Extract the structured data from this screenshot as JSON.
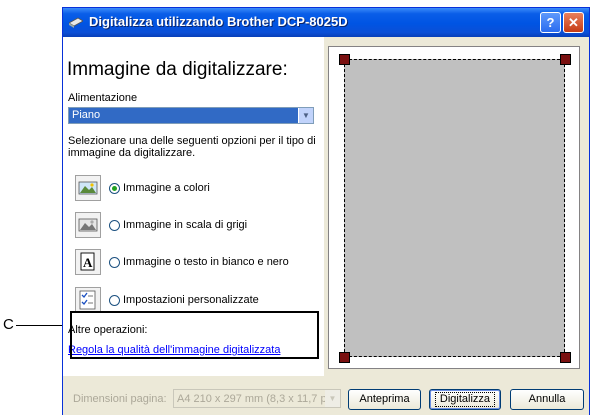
{
  "callout": {
    "letter": "C"
  },
  "window": {
    "title": "Digitalizza utilizzando Brother DCP-8025D",
    "help_label": "?",
    "close_label": "✕"
  },
  "left": {
    "heading": "Immagine da digitalizzare:",
    "source_label": "Alimentazione",
    "source_value": "Piano",
    "instructions": "Selezionare una delle seguenti opzioni per il tipo di immagine da digitalizzare.",
    "options": [
      {
        "label": "Immagine a colori",
        "icon": "color-picture-icon",
        "selected": true
      },
      {
        "label": "Immagine in scala di grigi",
        "icon": "grayscale-picture-icon",
        "selected": false
      },
      {
        "label": "Immagine o testo in bianco e nero",
        "icon": "black-white-text-icon",
        "selected": false
      },
      {
        "label": "Impostazioni personalizzate",
        "icon": "custom-settings-icon",
        "selected": false
      }
    ],
    "other_label": "Altre operazioni:",
    "link_text": "Regola la qualità dell'immagine digitalizzata"
  },
  "bottom": {
    "page_size_label": "Dimensioni pagina:",
    "page_size_value": "A4 210 x 297 mm (8,3 x 11,7 p",
    "preview_button": "Anteprima",
    "scan_button": "Digitalizza",
    "cancel_button": "Annulla"
  },
  "colors": {
    "title_bar": "#0054e3",
    "selection": "#316ac5",
    "scan_area": "#c0c0c0",
    "handle": "#7a1010",
    "link": "#0000ff"
  }
}
